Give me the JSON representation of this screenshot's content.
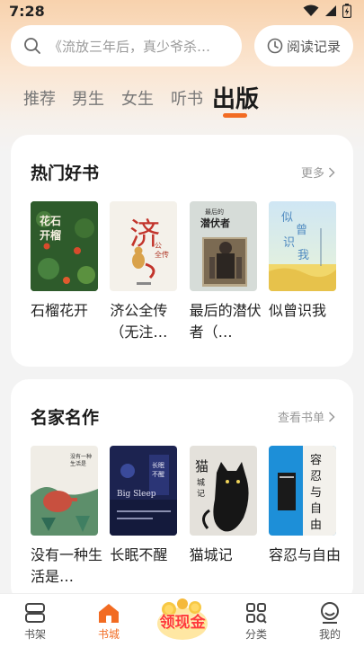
{
  "status_bar": {
    "time": "7:28"
  },
  "search": {
    "placeholder": "《流放三年后，真少爷杀…",
    "history_label": "阅读记录"
  },
  "tabs": [
    {
      "label": "推荐"
    },
    {
      "label": "男生"
    },
    {
      "label": "女生"
    },
    {
      "label": "听书"
    },
    {
      "label": "出版"
    }
  ],
  "sections": {
    "hot": {
      "title": "热门好书",
      "more_label": "更多",
      "books": [
        {
          "title": "石榴花开",
          "cover_text": "花开石榴"
        },
        {
          "title": "济公全传（无注…",
          "cover_text": "济",
          "cover_sub": "公全传"
        },
        {
          "title": "最后的潜伏者（…",
          "cover_text": "最后的潜伏者"
        },
        {
          "title": "似曾识我",
          "cover_text": "似曾识我"
        }
      ]
    },
    "classic": {
      "title": "名家名作",
      "more_label": "查看书单",
      "books": [
        {
          "title": "没有一种生活是…",
          "cover_text": "没有一种生活是完美"
        },
        {
          "title": "长眠不醒",
          "cover_text": "Big Sleep"
        },
        {
          "title": "猫城记",
          "cover_text": "猫城记"
        },
        {
          "title": "容忍与自由",
          "cover_text": "容忍与自由"
        }
      ]
    }
  },
  "bottom_nav": {
    "items": [
      {
        "label": "书架",
        "icon": "bookshelf-icon"
      },
      {
        "label": "书城",
        "icon": "home-icon"
      },
      {
        "label": "",
        "icon": "coin-icon"
      },
      {
        "label": "分类",
        "icon": "category-icon"
      },
      {
        "label": "我的",
        "icon": "profile-icon"
      }
    ],
    "coin_label": "领现金"
  },
  "colors": {
    "accent": "#f26b22",
    "coin_text": "#ff3b3b"
  }
}
